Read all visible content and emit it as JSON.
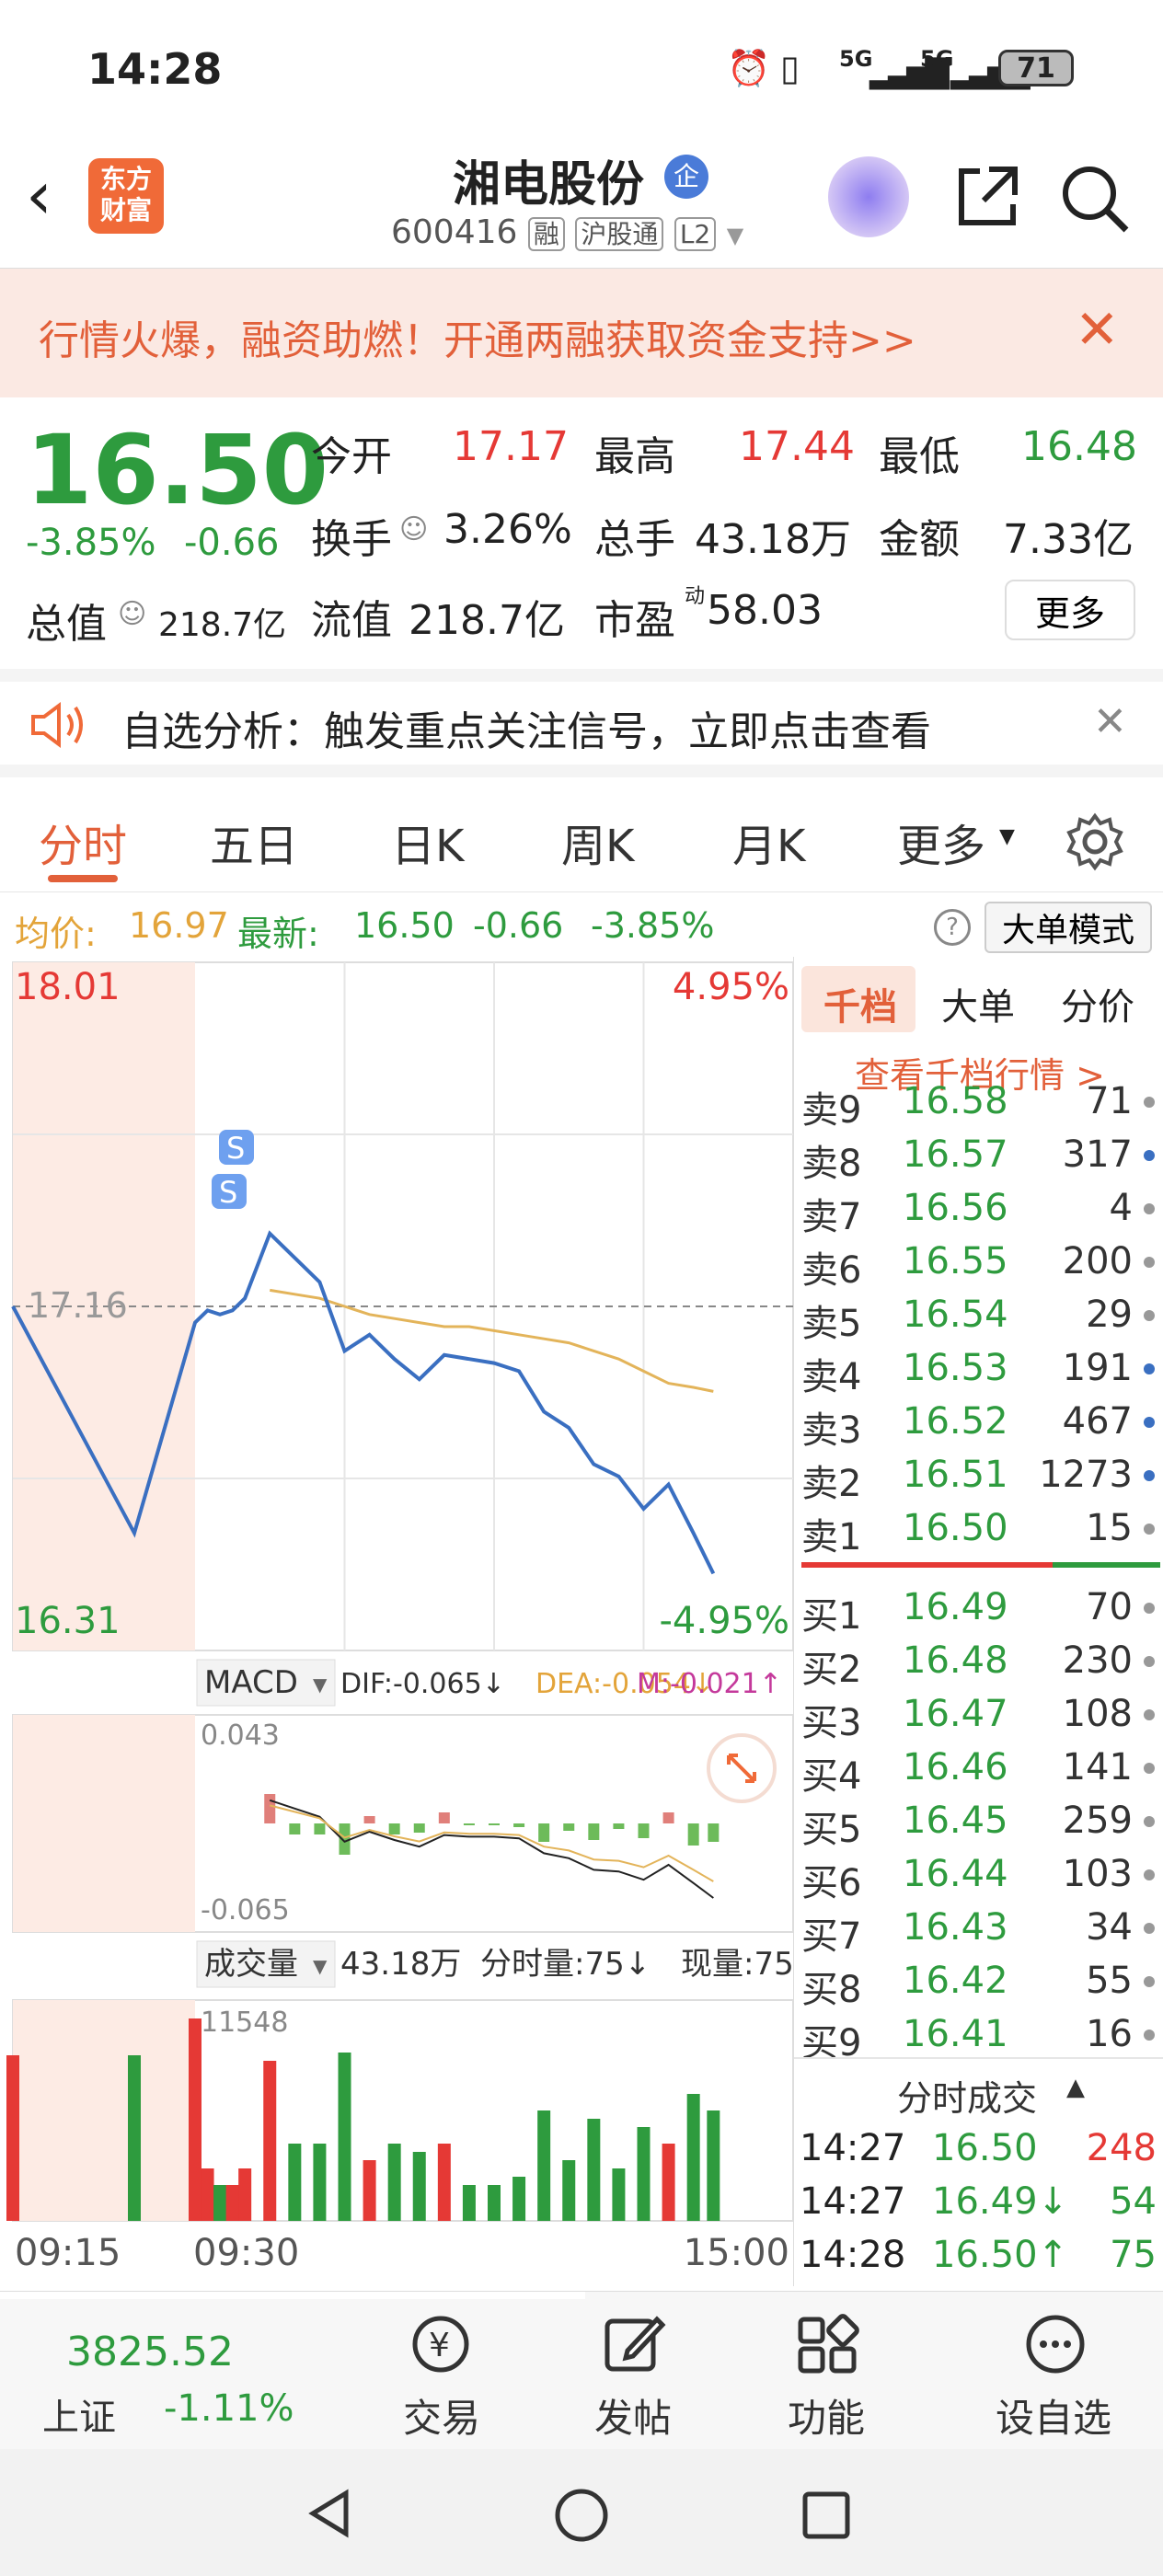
{
  "status": {
    "time": "14:28",
    "signal1": "5G",
    "signal2": "5G",
    "battery": "71"
  },
  "header": {
    "brand_line1": "东方",
    "brand_line2": "财富",
    "name": "湘电股份",
    "name_badge": "企",
    "code": "600416",
    "tag_margin": "融",
    "tag_connect": "沪股通",
    "tag_level": "L2"
  },
  "promo": {
    "text": "行情火爆，融资助燃！开通两融获取资金支持>>"
  },
  "quote": {
    "price": "16.50",
    "pct": "-3.85%",
    "chg": "-0.66",
    "open_label": "今开",
    "open": "17.17",
    "high_label": "最高",
    "high": "17.44",
    "low_label": "最低",
    "low": "16.48",
    "turnover_label": "换手",
    "turnover": "3.26%",
    "volume_label": "总手",
    "volume": "43.18万",
    "amount_label": "金额",
    "amount": "7.33亿",
    "mcap_label": "总值",
    "mcap": "218.7亿",
    "float_label": "流值",
    "float": "218.7亿",
    "pe_label": "市盈",
    "pe_sup": "动",
    "pe": "58.03",
    "more": "更多"
  },
  "analysis": {
    "text": "自选分析：触发重点关注信号，立即点击查看"
  },
  "tabs": {
    "t1": "分时",
    "t2": "五日",
    "t3": "日K",
    "t4": "周K",
    "t5": "月K",
    "t6": "更多"
  },
  "avgline": {
    "avg_label": "均价:",
    "avg": "16.97",
    "latest_label": "最新:",
    "latest": "16.50",
    "chg": "-0.66",
    "pct": "-3.85%",
    "mode": "大单模式"
  },
  "chart": {
    "y_top": "18.01",
    "y_bottom": "16.31",
    "pct_top": "4.95%",
    "pct_bottom": "-4.95%",
    "pre_close": "17.16",
    "macd_label": "MACD",
    "dif": "DIF:-0.065↓",
    "dea": "DEA:-0.054↓",
    "m": "M:-0.021↑",
    "macd_top": "0.043",
    "macd_bottom": "-0.065",
    "vol_label": "成交量",
    "vol_total": "43.18万",
    "vol_tick": "分时量:75↓",
    "vol_now": "现量:75",
    "vol_max": "11548",
    "t_start": "09:15",
    "t_mid": "09:30",
    "t_end": "15:00",
    "marker": "S"
  },
  "chart_data": {
    "type": "line",
    "title": "",
    "ylim": [
      16.31,
      18.01
    ],
    "pre_close": 17.16,
    "x": [
      "09:15",
      "09:25",
      "09:30",
      "09:35",
      "09:40",
      "09:45",
      "09:50",
      "10:00",
      "10:10",
      "10:20",
      "10:30",
      "10:40",
      "10:50",
      "11:00",
      "11:10",
      "11:20",
      "11:30",
      "13:10",
      "13:20",
      "13:30",
      "13:40",
      "13:50",
      "14:00",
      "14:10",
      "14:20",
      "14:28"
    ],
    "series": [
      {
        "name": "",
        "color": "#3a6fc1",
        "values": [
          17.16,
          16.6,
          17.12,
          17.15,
          17.14,
          17.15,
          17.18,
          17.34,
          17.28,
          17.22,
          17.05,
          17.09,
          17.03,
          16.98,
          17.04,
          17.03,
          17.02,
          17.0,
          16.9,
          16.86,
          16.77,
          16.74,
          16.66,
          16.72,
          16.6,
          16.5
        ]
      },
      {
        "name": "",
        "color": "#e3b45a",
        "values": [
          null,
          null,
          null,
          null,
          null,
          null,
          null,
          17.2,
          17.19,
          17.18,
          17.16,
          17.14,
          17.13,
          17.12,
          17.11,
          17.11,
          17.1,
          17.09,
          17.08,
          17.07,
          17.05,
          17.03,
          17.0,
          16.97,
          16.96,
          16.95
        ]
      }
    ]
  },
  "book": {
    "tab1": "千档",
    "tab2": "大单",
    "tab3": "分价",
    "link": "查看千档行情 >",
    "asks": [
      {
        "label": "卖9",
        "price": "16.58",
        "vol": "71",
        "dot": "#999"
      },
      {
        "label": "卖8",
        "price": "16.57",
        "vol": "317",
        "dot": "#3a6fc1"
      },
      {
        "label": "卖7",
        "price": "16.56",
        "vol": "4",
        "dot": "#999"
      },
      {
        "label": "卖6",
        "price": "16.55",
        "vol": "200",
        "dot": "#999"
      },
      {
        "label": "卖5",
        "price": "16.54",
        "vol": "29",
        "dot": "#999"
      },
      {
        "label": "卖4",
        "price": "16.53",
        "vol": "191",
        "dot": "#3a6fc1"
      },
      {
        "label": "卖3",
        "price": "16.52",
        "vol": "467",
        "dot": "#3a6fc1"
      },
      {
        "label": "卖2",
        "price": "16.51",
        "vol": "1273",
        "dot": "#3a6fc1"
      },
      {
        "label": "卖1",
        "price": "16.50",
        "vol": "15",
        "dot": "#999"
      }
    ],
    "bids": [
      {
        "label": "买1",
        "price": "16.49",
        "vol": "70",
        "dot": "#999"
      },
      {
        "label": "买2",
        "price": "16.48",
        "vol": "230",
        "dot": "#999"
      },
      {
        "label": "买3",
        "price": "16.47",
        "vol": "108",
        "dot": "#999"
      },
      {
        "label": "买4",
        "price": "16.46",
        "vol": "141",
        "dot": "#999"
      },
      {
        "label": "买5",
        "price": "16.45",
        "vol": "259",
        "dot": "#999"
      },
      {
        "label": "买6",
        "price": "16.44",
        "vol": "103",
        "dot": "#999"
      },
      {
        "label": "买7",
        "price": "16.43",
        "vol": "34",
        "dot": "#999"
      },
      {
        "label": "买8",
        "price": "16.42",
        "vol": "55",
        "dot": "#999"
      },
      {
        "label": "买9",
        "price": "16.41",
        "vol": "16",
        "dot": "#999"
      }
    ],
    "trades_title": "分时成交",
    "trades": [
      {
        "time": "14:27",
        "price": "16.50",
        "arrow": "",
        "vol": "248",
        "pcolor": "#2e9b3e",
        "vcolor": "#e53935"
      },
      {
        "time": "14:27",
        "price": "16.49",
        "arrow": "↓",
        "vol": "54",
        "pcolor": "#2e9b3e",
        "vcolor": "#2e9b3e"
      },
      {
        "time": "14:28",
        "price": "16.50",
        "arrow": "↑",
        "vol": "75",
        "pcolor": "#2e9b3e",
        "vcolor": "#2e9b3e"
      }
    ]
  },
  "bottomnav": {
    "index_value": "3825.52",
    "index_name": "上证",
    "index_pct": "-1.11%",
    "trade": "交易",
    "post": "发帖",
    "features": "功能",
    "add_watch": "设自选"
  },
  "colors": {
    "up": "#e53935",
    "down": "#2e9b3e",
    "accent": "#f06a38",
    "price_line": "#3a6fc1",
    "avg_line": "#e3b45a"
  }
}
